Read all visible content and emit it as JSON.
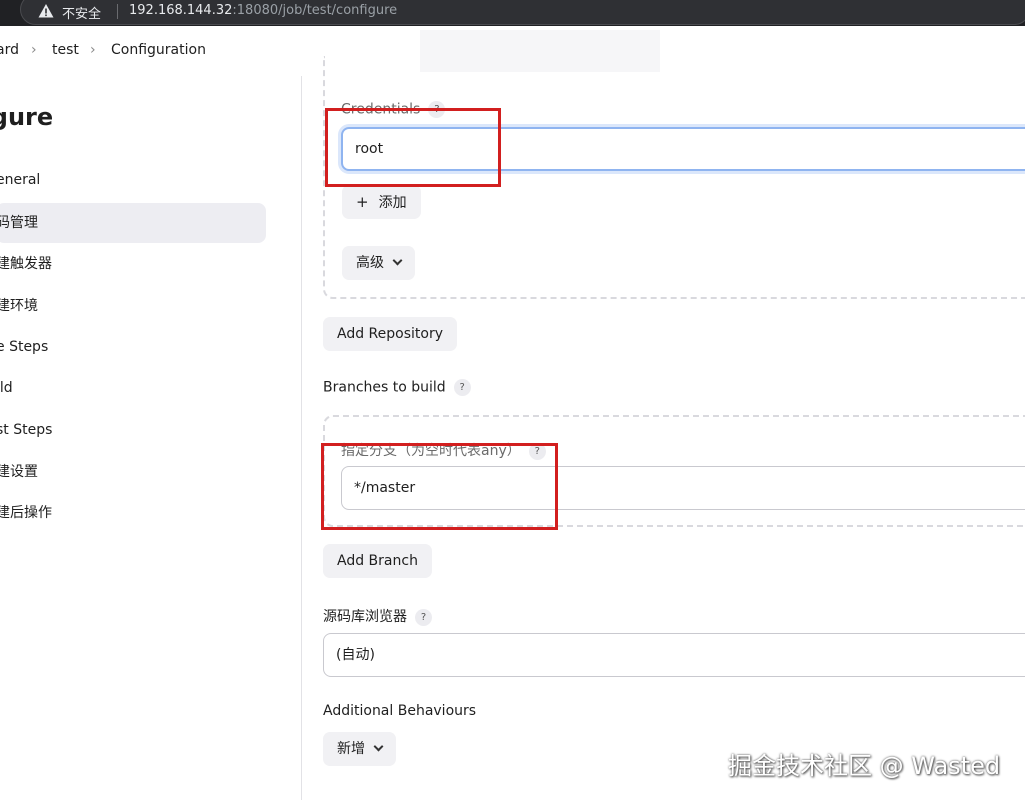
{
  "browser": {
    "left_glyph": "‹",
    "security_label": "不安全",
    "url_host": "192.168.144.32",
    "url_rest": ":18080/job/test/configure"
  },
  "breadcrumb": {
    "items": [
      "ard",
      "test",
      "Configuration"
    ],
    "separator": "›"
  },
  "sidebar": {
    "title": "figure",
    "items": [
      {
        "label": "eneral"
      },
      {
        "label": "码管理"
      },
      {
        "label": "建触发器"
      },
      {
        "label": "建环境"
      },
      {
        "label": "e Steps"
      },
      {
        "label": "ild"
      },
      {
        "label": "st Steps"
      },
      {
        "label": "建设置"
      },
      {
        "label": "建后操作"
      }
    ]
  },
  "scm": {
    "credentials_label": "Credentials",
    "credentials_value": "root",
    "add_button": "添加",
    "add_icon": "+",
    "advanced_button": "高级",
    "add_repository_button": "Add Repository",
    "branches_label": "Branches to build",
    "branch_specifier_label": "指定分支（为空时代表any）",
    "branch_value": "*/master",
    "add_branch_button": "Add Branch",
    "repo_browser_label": "源码库浏览器",
    "repo_browser_value": "(自动)",
    "additional_behaviours_label": "Additional Behaviours",
    "new_button": "新增",
    "help_glyph": "?"
  },
  "watermark": "掘金技术社区 @ Wasted",
  "colors": {
    "highlight_box": "#d21f1f",
    "focus_ring": "#8fb4f0",
    "active_sidebar": "#ededf2"
  }
}
